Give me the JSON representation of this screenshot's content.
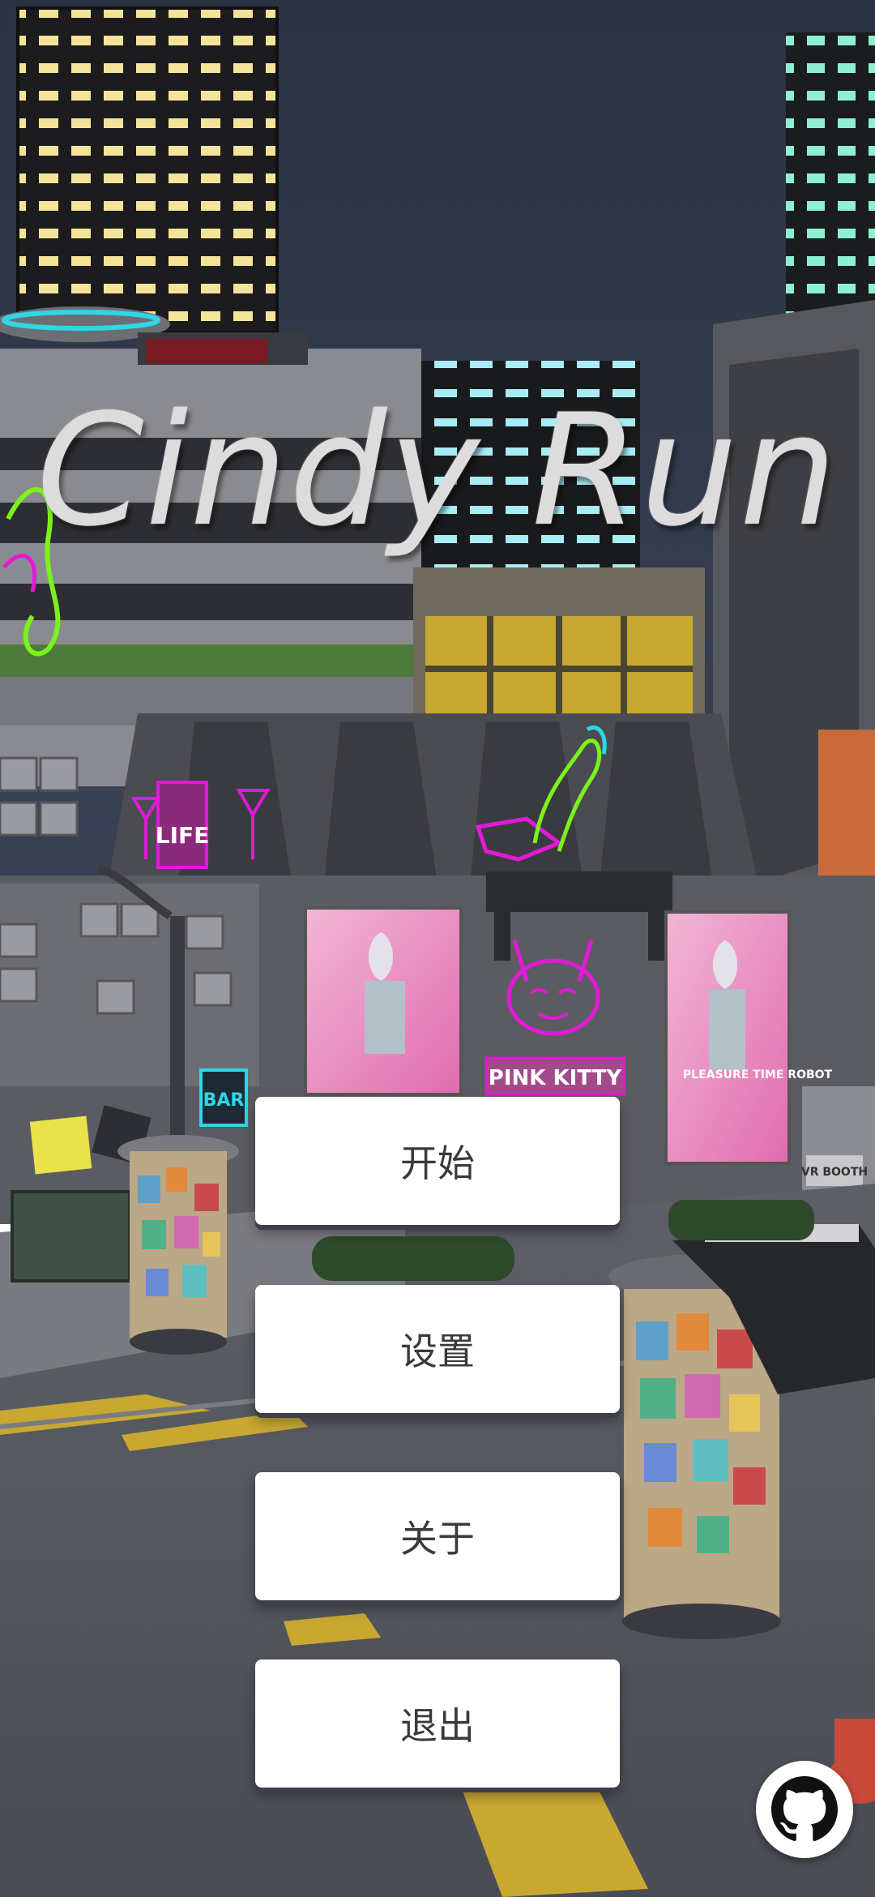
{
  "game": {
    "title": "Cindy Run"
  },
  "menu": {
    "start_label": "开始",
    "settings_label": "设置",
    "about_label": "关于",
    "exit_label": "退出"
  },
  "scene_signs": {
    "club_sign": "PINK KITTY",
    "bar_sign": "BAR",
    "life_sign": "LIFE",
    "poster_text": "PLEASURE TIME ROBOT",
    "booth_sign": "VR BOOTH"
  },
  "icons": {
    "github": "github-icon"
  },
  "colors": {
    "sky": "#2c3446",
    "button_bg": "#ffffff",
    "button_text": "#3a3a3a",
    "neon_pink": "#e21ad6",
    "neon_green": "#7cf21a",
    "neon_cyan": "#2fd6e6"
  }
}
